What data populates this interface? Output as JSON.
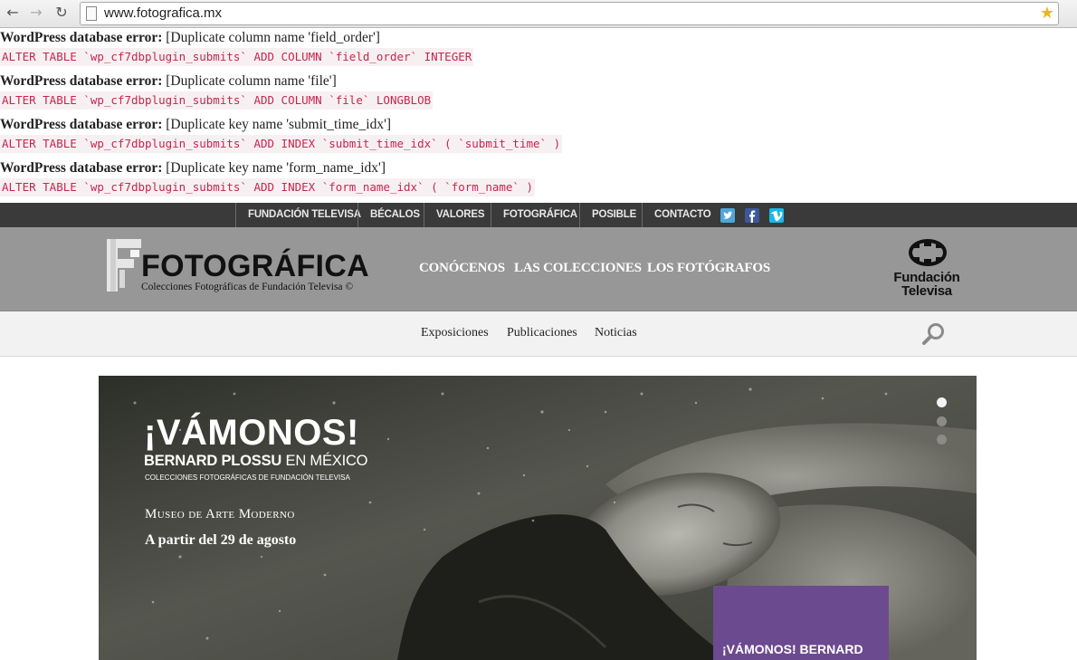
{
  "browser": {
    "url": "www.fotografica.mx"
  },
  "errors": [
    {
      "label": "WordPress database error:",
      "message": "[Duplicate column name 'field_order']",
      "sql": "ALTER TABLE `wp_cf7dbplugin_submits` ADD COLUMN `field_order` INTEGER"
    },
    {
      "label": "WordPress database error:",
      "message": "[Duplicate column name 'file']",
      "sql": "ALTER TABLE `wp_cf7dbplugin_submits` ADD COLUMN `file` LONGBLOB"
    },
    {
      "label": "WordPress database error:",
      "message": "[Duplicate key name 'submit_time_idx']",
      "sql": "ALTER TABLE `wp_cf7dbplugin_submits` ADD INDEX `submit_time_idx` ( `submit_time` )"
    },
    {
      "label": "WordPress database error:",
      "message": "[Duplicate key name 'form_name_idx']",
      "sql": "ALTER TABLE `wp_cf7dbplugin_submits` ADD INDEX `form_name_idx` ( `form_name` )"
    }
  ],
  "topbar": {
    "items": [
      "FUNDACIÓN TELEVISA",
      "BÉCALOS",
      "VALORES",
      "FOTOGRÁFICA",
      "POSIBLE",
      "CONTACTO"
    ],
    "social_icons": [
      "twitter-icon",
      "facebook-icon",
      "vimeo-icon"
    ],
    "colors": {
      "twitter": "#4fa6d9",
      "facebook": "#3b5998",
      "vimeo": "#1ab7ea"
    }
  },
  "header": {
    "logo_text": "FOTOGRÁFICA",
    "logo_subtitle": "Colecciones Fotográficas de Fundación Televisa ©",
    "nav": [
      "CONÓCENOS",
      "LAS COLECCIONES",
      "LOS FOTÓGRAFOS"
    ],
    "partner_logo": {
      "line1": "Fundación",
      "line2": "Televisa"
    }
  },
  "subnav": {
    "items": [
      "Exposiciones",
      "Publicaciones",
      "Noticias"
    ]
  },
  "hero": {
    "title": "¡VÁMONOS!",
    "subtitle_bold": "BERNARD PLOSSU",
    "subtitle_rest": " EN MÉXICO",
    "small_caption": "COLECCIONES FOTOGRÁFICAS DE FUNDACIÓN TELEVISA",
    "museum": "Museo de Arte Moderno",
    "date": "A partir del 29 de agosto",
    "slides_total": 3,
    "active_slide": 1,
    "promo_label": "¡VÁMONOS! BERNARD",
    "promo_color": "#6c4a8f"
  }
}
